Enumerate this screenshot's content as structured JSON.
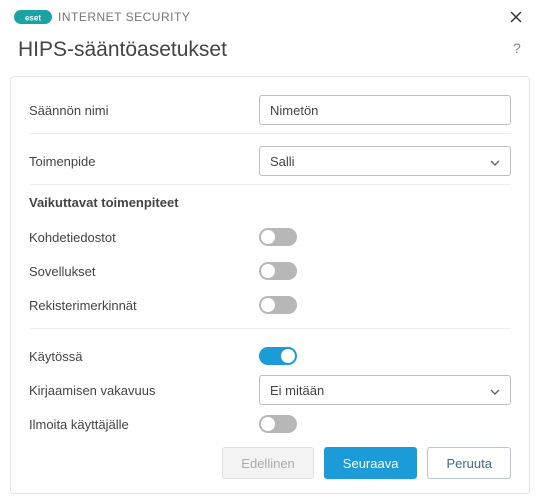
{
  "titlebar": {
    "brand": "eset",
    "product": "INTERNET SECURITY"
  },
  "header": {
    "title": "HIPS-sääntöasetukset"
  },
  "fields": {
    "rule_name": {
      "label": "Säännön nimi",
      "value": "Nimetön"
    },
    "action": {
      "label": "Toimenpide",
      "value": "Salli"
    },
    "affecting_ops_header": "Vaikuttavat toimenpiteet",
    "target_files": {
      "label": "Kohdetiedostot",
      "on": false
    },
    "applications": {
      "label": "Sovellukset",
      "on": false
    },
    "registry_entries": {
      "label": "Rekisterimerkinnät",
      "on": false
    },
    "enabled": {
      "label": "Käytössä",
      "on": true
    },
    "log_severity": {
      "label": "Kirjaamisen vakavuus",
      "value": "Ei mitään"
    },
    "notify_user": {
      "label": "Ilmoita käyttäjälle",
      "on": false
    }
  },
  "footer": {
    "previous": "Edellinen",
    "next": "Seuraava",
    "cancel": "Peruuta"
  }
}
